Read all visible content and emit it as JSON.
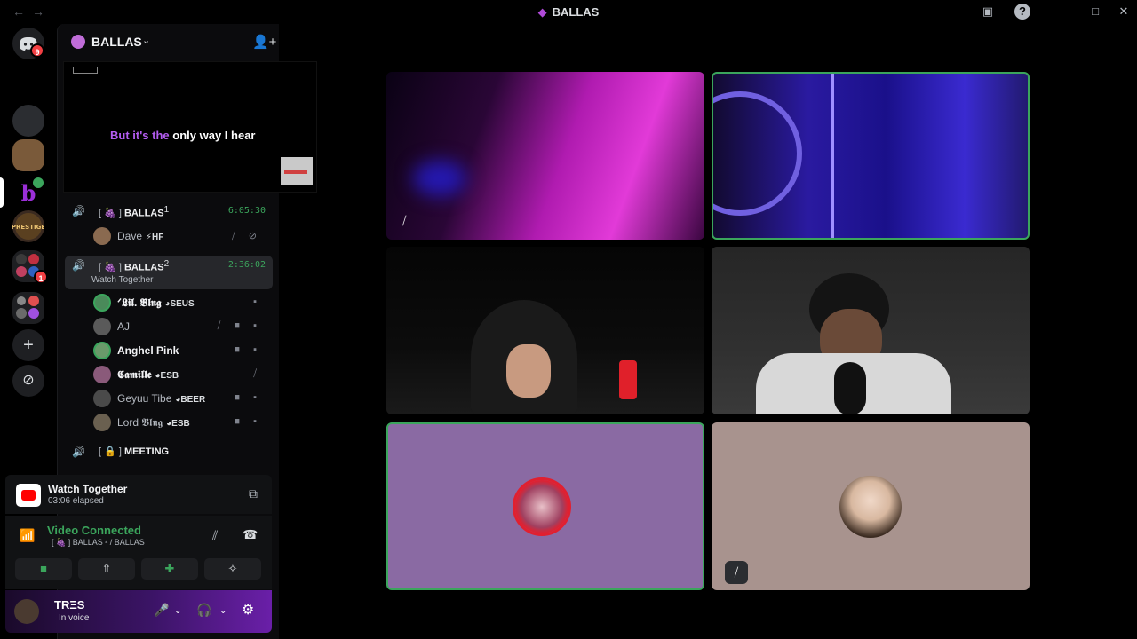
{
  "window": {
    "title": "BALLAS",
    "back_glyph": "←",
    "forward_glyph": "→"
  },
  "rail": {
    "home_badge": "9",
    "folder_badge": "1",
    "add_glyph": "+",
    "explore_glyph": "⊘"
  },
  "server": {
    "name": "BALLAS",
    "caret": "⌄",
    "invite_glyph": "👤+"
  },
  "activity": {
    "lyric_highlight": "But it's the",
    "lyric_rest": "only way I hear"
  },
  "channels": [
    {
      "bracket": "[ 🍇 ]",
      "name": "BALLAS",
      "sup": "1",
      "timer": "6:05:30"
    },
    {
      "bracket": "[ 🍇 ]",
      "name": "BALLAS",
      "sup": "2",
      "timer": "2:36:02",
      "subtitle": "Watch Together"
    },
    {
      "bracket": "[ 🔒 ]",
      "name": "MEETING"
    }
  ],
  "members_ch1": [
    {
      "name": "Dave",
      "tag": "⚡HF",
      "icons": "⧸ ⊘"
    }
  ],
  "members_ch2": [
    {
      "name": "ᐟ𝕷𝖎𝖑. 𝕭𝖑𝖓𝖌",
      "tag": "◕SEUS",
      "icons": "▪"
    },
    {
      "name": "AJ",
      "tag": "",
      "icons": "⧸ ■ ▪"
    },
    {
      "name": "Anghel Pink",
      "tag": "",
      "icons": "■ ▪"
    },
    {
      "name": "𝕮𝖆𝖒𝖎𝖑𝖑𝖊",
      "tag": "◕ESB",
      "icons": "⧸"
    },
    {
      "name": "Geyuu Tibe",
      "tag": "◕BEER",
      "icons": "■ ▪"
    },
    {
      "name": "Lord 𝕭𝖑𝖓𝖌",
      "tag": "◕ESB",
      "icons": "■ ▪"
    }
  ],
  "watch_panel": {
    "title": "Watch Together",
    "elapsed": "03:06 elapsed"
  },
  "voice_panel": {
    "status": "Video Connected",
    "location": "[ 🍇 ] BALLAS ² / BALLAS",
    "camera_glyph": "■",
    "screen_glyph": "⇧",
    "activity_glyph": "✚",
    "soundboard_glyph": "✧"
  },
  "user": {
    "name": "TRΞS",
    "status": "In voice",
    "mic_glyph": "🎤",
    "headset_glyph": "🎧",
    "settings_glyph": "⚙"
  },
  "colors": {
    "accent_green": "#3ba55c",
    "sidebar_bg": "#0b0b0d",
    "purple_tile": "#8a6aa3",
    "beige_tile": "#a8938e"
  }
}
